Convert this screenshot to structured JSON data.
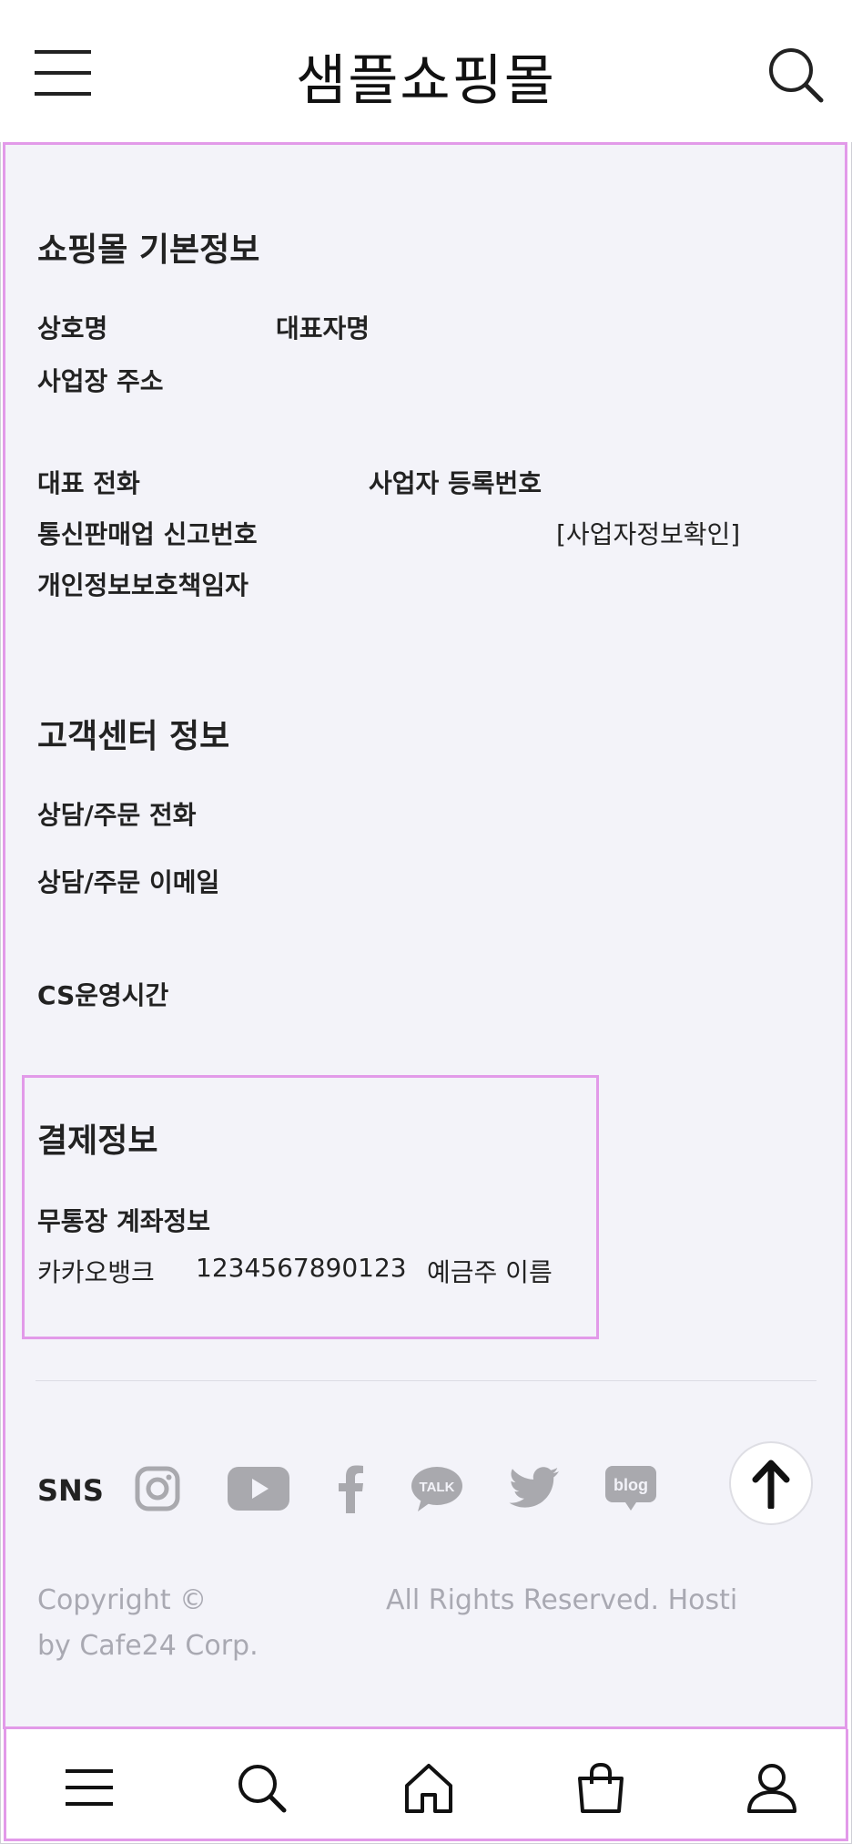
{
  "header": {
    "title": "샘플쇼핑몰",
    "menu_icon": "hamburger-menu-icon",
    "search_icon": "search-icon"
  },
  "shop_info": {
    "heading": "쇼핑몰 기본정보",
    "company_name_label": "상호명",
    "ceo_name_label": "대표자명",
    "address_label": "사업장 주소",
    "phone_label": "대표 전화",
    "biz_reg_no_label": "사업자 등록번호",
    "mail_order_label": "통신판매업 신고번호",
    "biz_info_link": "[사업자정보확인]",
    "privacy_officer_label": "개인정보보호책임자"
  },
  "cs_info": {
    "heading": "고객센터 정보",
    "phone_label": "상담/주문 전화",
    "email_label": "상담/주문 이메일",
    "hours_label": "CS운영시간"
  },
  "payment_info": {
    "heading": "결제정보",
    "account_label": "무통장 계좌정보",
    "bank": "카카오뱅크",
    "account_number": "1234567890123",
    "holder": "예금주 이름"
  },
  "sns": {
    "label": "SNS",
    "icons": [
      "instagram-icon",
      "youtube-icon",
      "facebook-icon",
      "kakaotalk-icon",
      "twitter-icon",
      "blog-icon"
    ],
    "talk_text": "TALK",
    "blog_text": "blog"
  },
  "copyright": {
    "line1_left": "Copyright ©",
    "line1_right": "All Rights Reserved. Hosti",
    "line2": "by Cafe24 Corp."
  },
  "bottom_nav": {
    "items": [
      "menu-icon",
      "search-icon",
      "home-icon",
      "cart-icon",
      "my-page-icon"
    ]
  },
  "colors": {
    "accent_outline": "#e29ae9",
    "footer_bg": "#f3f3f9",
    "icon_gray": "#a9a9ae"
  }
}
